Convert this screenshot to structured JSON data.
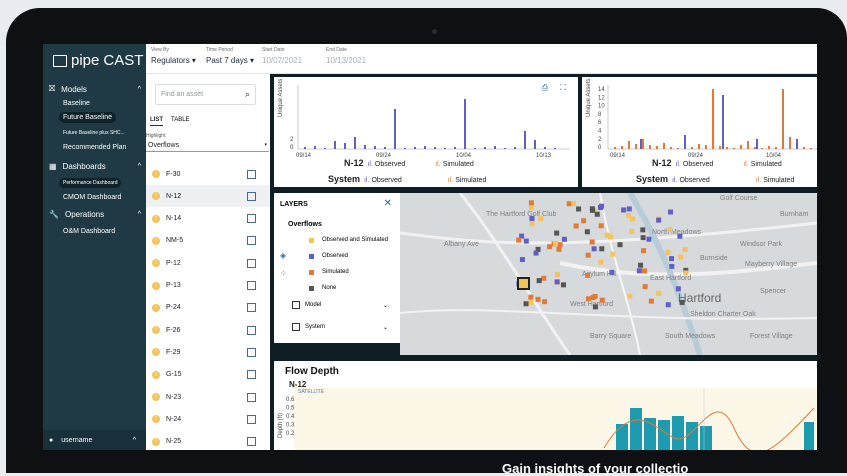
{
  "app": {
    "brand_name": "pipe",
    "brand_suffix": "CAST",
    "close_glyph": "×"
  },
  "sidebar": {
    "sections": [
      {
        "label": "Models",
        "icon": "model-icon",
        "items": [
          "Baseline",
          "Future Baseline",
          "Future Baseline plus SHC...",
          "Recommended Plan"
        ]
      },
      {
        "label": "Dashboards",
        "icon": "dashboard-icon",
        "items": [
          "Performance Dashboard",
          "CMOM Dashboard"
        ]
      },
      {
        "label": "Operations",
        "icon": "wrench-icon",
        "items": [
          "O&M Dashboard"
        ]
      }
    ],
    "user": "username"
  },
  "toolbar": {
    "view_by_label": "View By",
    "view_by_value": "Regulators",
    "time_period_label": "Time Period",
    "time_period_value": "Past 7 days",
    "start_date_label": "Start Date",
    "start_date_value": "10/07/2021",
    "end_date_label": "End Date",
    "end_date_value": "10/13/2021"
  },
  "asset_list": {
    "search_placeholder": "Find an asset",
    "tabs": [
      "LIST",
      "TABLE"
    ],
    "highlight_label": "Highlight",
    "highlight_value": "Overflows",
    "rows": [
      "F-30",
      "N-12",
      "N-14",
      "NM-5",
      "P-12",
      "P-13",
      "P-24",
      "F-26",
      "F-29",
      "G-15",
      "N-23",
      "N-24",
      "N-25"
    ],
    "selected": "N-12"
  },
  "chart1": {
    "ylabel": "Unique Assets",
    "yticks": [
      "2",
      "0"
    ],
    "xticks": [
      "09/14",
      "09/24",
      "10/04",
      "10/13"
    ],
    "legend_row1": {
      "name": "N-12",
      "observed": "Observed",
      "simulated": "Simulated"
    },
    "legend_row2": {
      "name": "System",
      "observed": "Observed",
      "simulated": "Simulated"
    }
  },
  "chart2": {
    "ylabel": "Unique Assets",
    "yticks": [
      "14",
      "12",
      "10",
      "8",
      "6",
      "4",
      "2",
      "0"
    ],
    "xticks": [
      "09/14",
      "09/24",
      "10/04"
    ],
    "legend_row1": {
      "name": "N-12",
      "observed": "Observed",
      "simulated": "Simulated"
    },
    "legend_row2": {
      "name": "System",
      "observed": "Observed",
      "simulated": "Simulated"
    }
  },
  "layers": {
    "title": "LAYERS",
    "section": "Overflows",
    "legend": [
      {
        "label": "Observed and Simulated",
        "color": "#f4c35a"
      },
      {
        "label": "Observed",
        "color": "#5f5fc4"
      },
      {
        "label": "Simulated",
        "color": "#e07a36"
      },
      {
        "label": "None",
        "color": "#555555"
      }
    ],
    "checkboxes": [
      "Model",
      "System"
    ]
  },
  "map": {
    "labels": [
      "Golf Course",
      "Burnham",
      "The Hartford Golf Club",
      "Albany Ave",
      "North Meadows",
      "Windsor Park",
      "Burnside",
      "Mayberry Village",
      "Asylum Hill",
      "East Hartford",
      "Hartford",
      "West Hartford",
      "Spencer",
      "Sheldon Charter Oak",
      "Barry Square",
      "South Meadows",
      "Forest Village"
    ]
  },
  "flow": {
    "title": "Flow Depth",
    "asset": "N-12",
    "ylabel": "Depth (ft)",
    "yticks": [
      "0.6",
      "0.5",
      "0.4",
      "0.3",
      "0.2"
    ],
    "badge": "SATELLITE"
  },
  "banner": {
    "text": "Gain insights of your collectio"
  }
}
